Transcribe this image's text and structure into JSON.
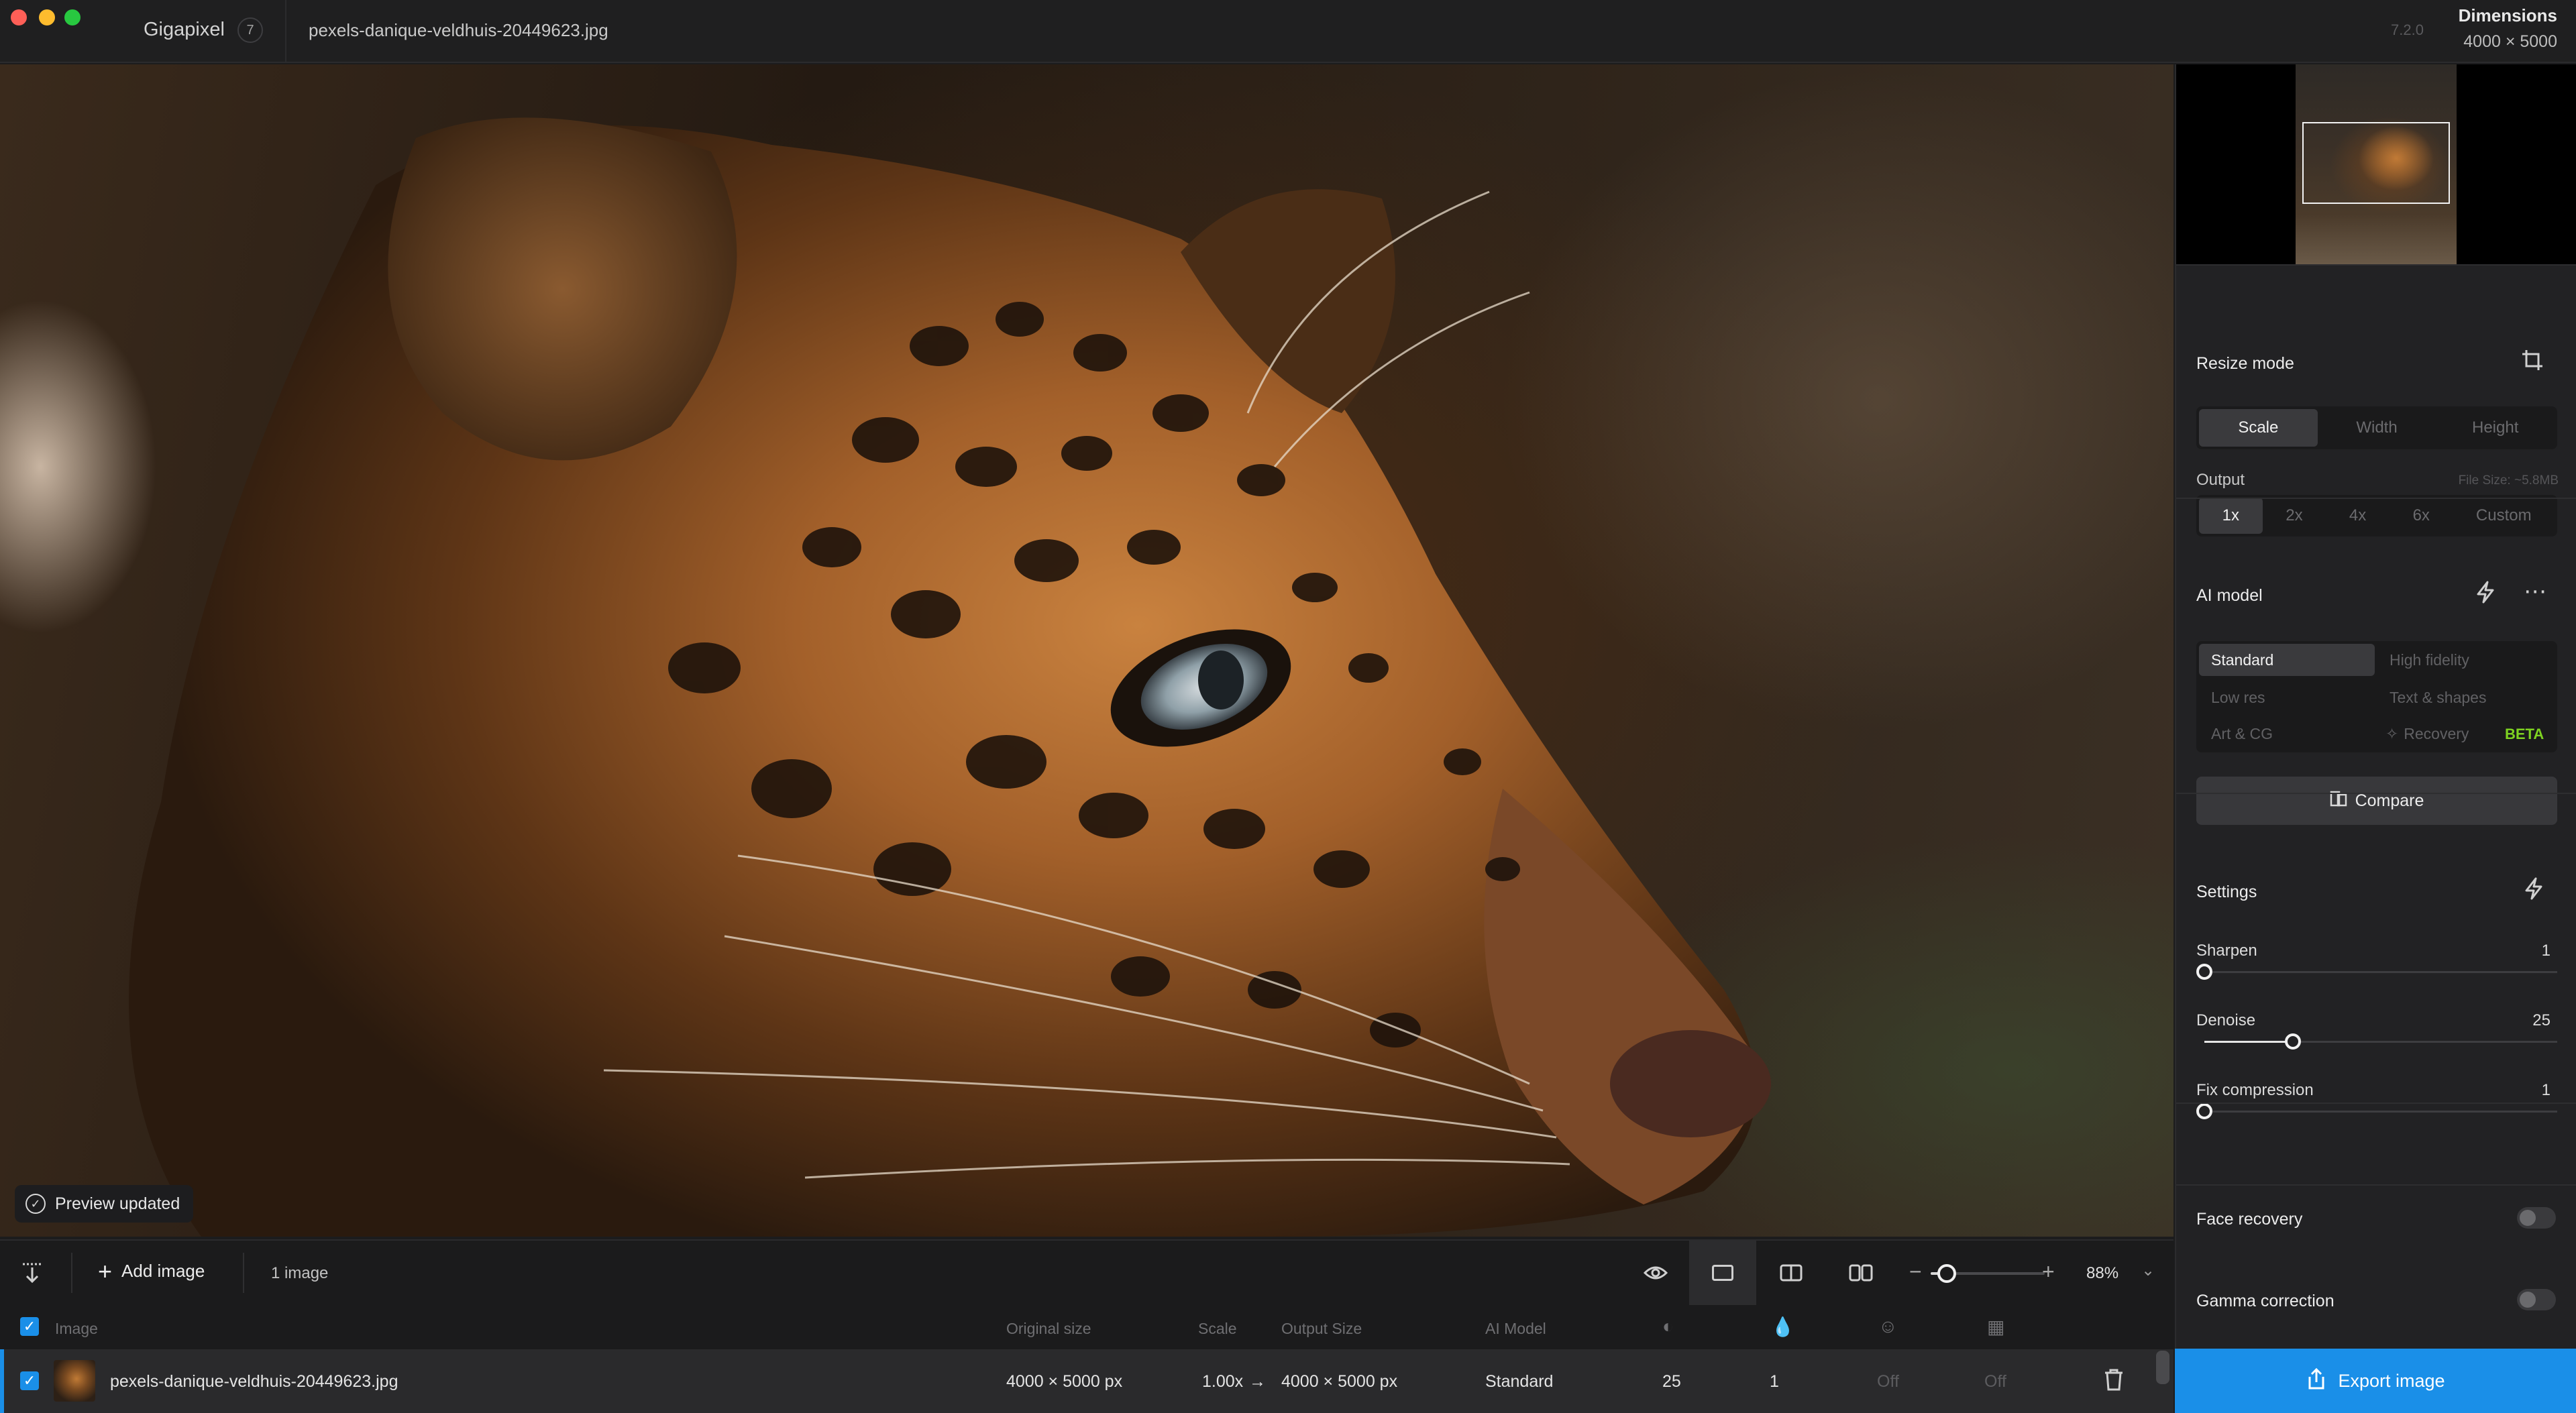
{
  "titlebar": {
    "app_name": "Gigapixel",
    "app_badge": "7",
    "filename": "pexels-danique-veldhuis-20449623.jpg",
    "version": "7.2.0",
    "dimensions_label": "Dimensions",
    "dimensions_value": "4000 × 5000"
  },
  "canvas": {
    "toast": "Preview updated"
  },
  "toolbar": {
    "add_image": "Add image",
    "image_count": "1 image",
    "zoom_value": 0.14,
    "zoom_label": "88%"
  },
  "table": {
    "headers": {
      "image": "Image",
      "original_size": "Original size",
      "scale": "Scale",
      "output_size": "Output Size",
      "ai_model": "AI Model"
    },
    "row": {
      "name": "pexels-danique-veldhuis-20449623.jpg",
      "original_size": "4000 × 5000 px",
      "scale": "1.00x",
      "arrow": "→",
      "output_size": "4000 × 5000 px",
      "ai_model": "Standard",
      "denoise": "25",
      "sharpen": "1",
      "face": "Off",
      "gamma": "Off"
    }
  },
  "panel": {
    "resize": {
      "title": "Resize mode",
      "modes": [
        "Scale",
        "Width",
        "Height"
      ],
      "active_mode": "Scale",
      "output_label": "Output",
      "file_size": "File Size: ~5.8MB",
      "outputs": [
        "1x",
        "2x",
        "4x",
        "6x",
        "Custom"
      ],
      "active_output": "1x"
    },
    "ai_model": {
      "title": "AI model",
      "models": [
        "Standard",
        "High fidelity",
        "Low res",
        "Text & shapes",
        "Art & CG",
        "Recovery"
      ],
      "active": "Standard",
      "beta": "BETA",
      "compare": "Compare"
    },
    "settings": {
      "title": "Settings",
      "sharpen_label": "Sharpen",
      "sharpen_value": "1",
      "sharpen_level": 0.0,
      "denoise_label": "Denoise",
      "denoise_value": "25",
      "denoise_level": 0.25,
      "fix_label": "Fix compression",
      "fix_value": "1",
      "fix_level": 0.0
    },
    "face_recovery": "Face recovery",
    "gamma_correction": "Gamma correction",
    "export": "Export image"
  },
  "colors": {
    "accent": "#1a8fe8",
    "beta": "#7ed321",
    "background": "#1c1c1d",
    "panel": "#222224"
  },
  "icons": [
    "import-icon",
    "plus-icon",
    "eye-icon",
    "single-view-icon",
    "split-view-icon",
    "side-by-side-icon",
    "crop-icon",
    "lightning-icon",
    "more-icon",
    "compare-icon",
    "check-circle-icon",
    "trash-icon",
    "export-icon"
  ]
}
